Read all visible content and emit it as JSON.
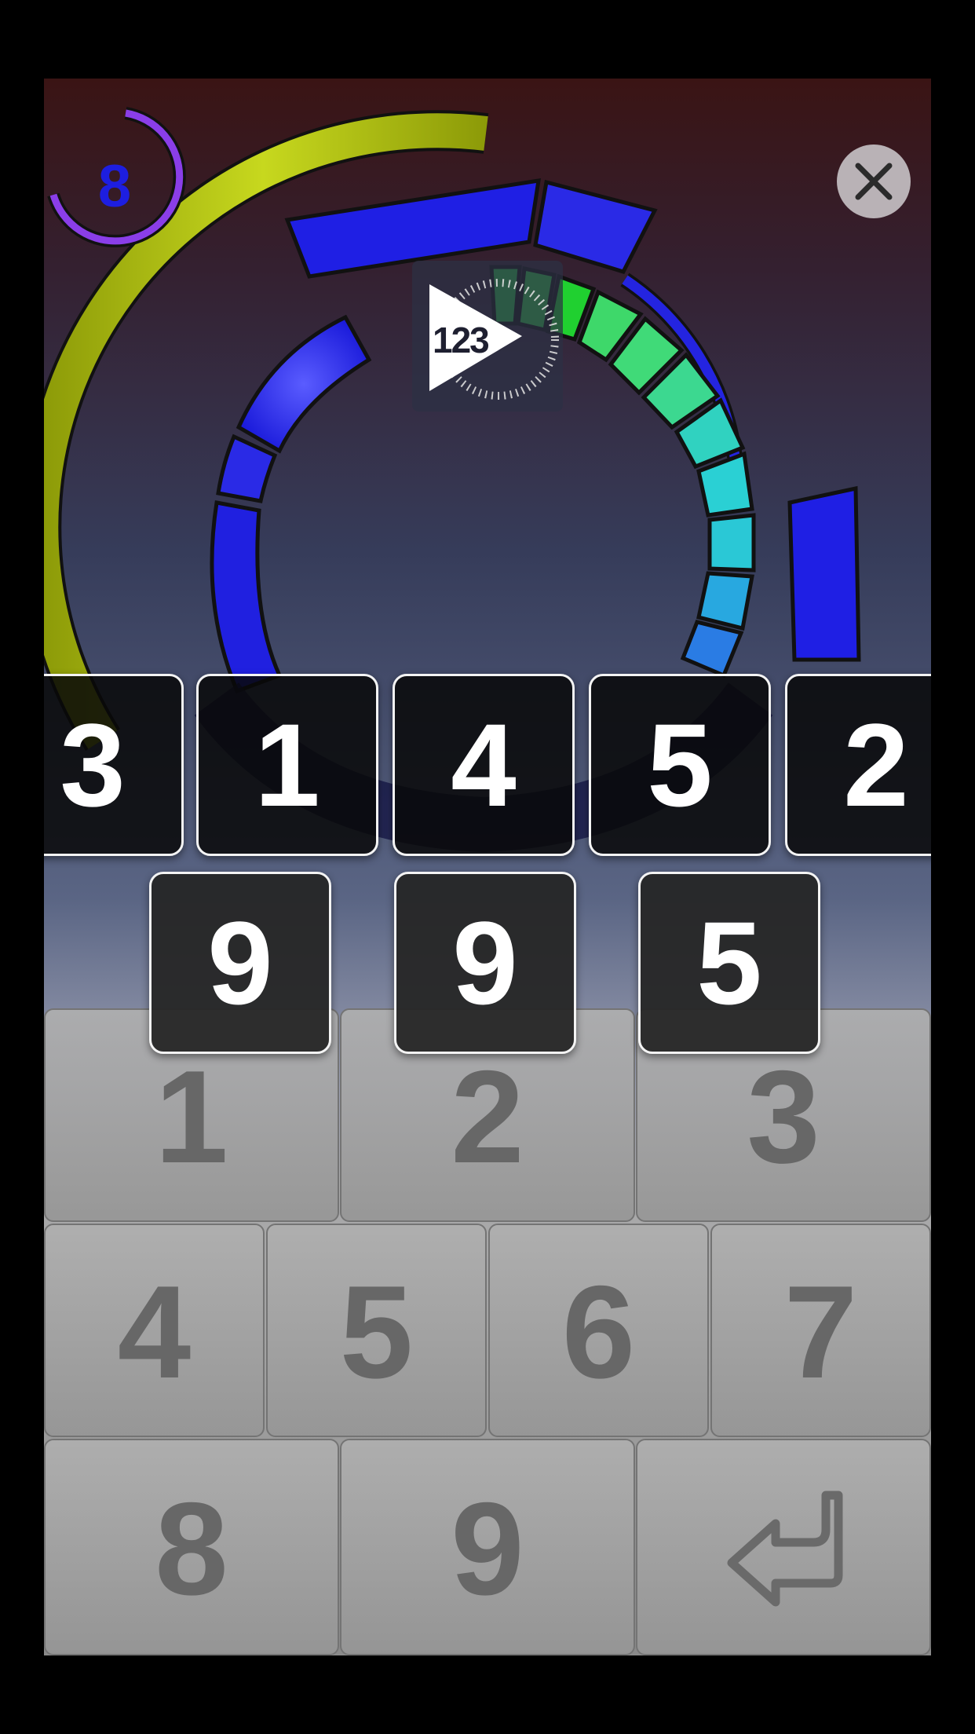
{
  "hud": {
    "timer_count": "8",
    "timer_color": "#1d1ee0",
    "close_icon": "close-x-icon",
    "logo_text": "123",
    "logo_icon": "play-triangle-stopwatch-icon"
  },
  "sequence": {
    "row1": [
      "3",
      "1",
      "4",
      "5",
      "2"
    ],
    "row2": [
      "9",
      "9",
      "5"
    ]
  },
  "keypad": {
    "keys": [
      "1",
      "2",
      "3",
      "4",
      "5",
      "6",
      "7",
      "8",
      "9"
    ],
    "enter_icon": "return-arrow-icon"
  },
  "colors": {
    "outer_arc": "#b5c414",
    "segments_blue": "#1f1fe4",
    "segments_green": "#3ed86a",
    "segments_cyan": "#2ad0d4",
    "timer_ring": "#8a3ee8"
  }
}
